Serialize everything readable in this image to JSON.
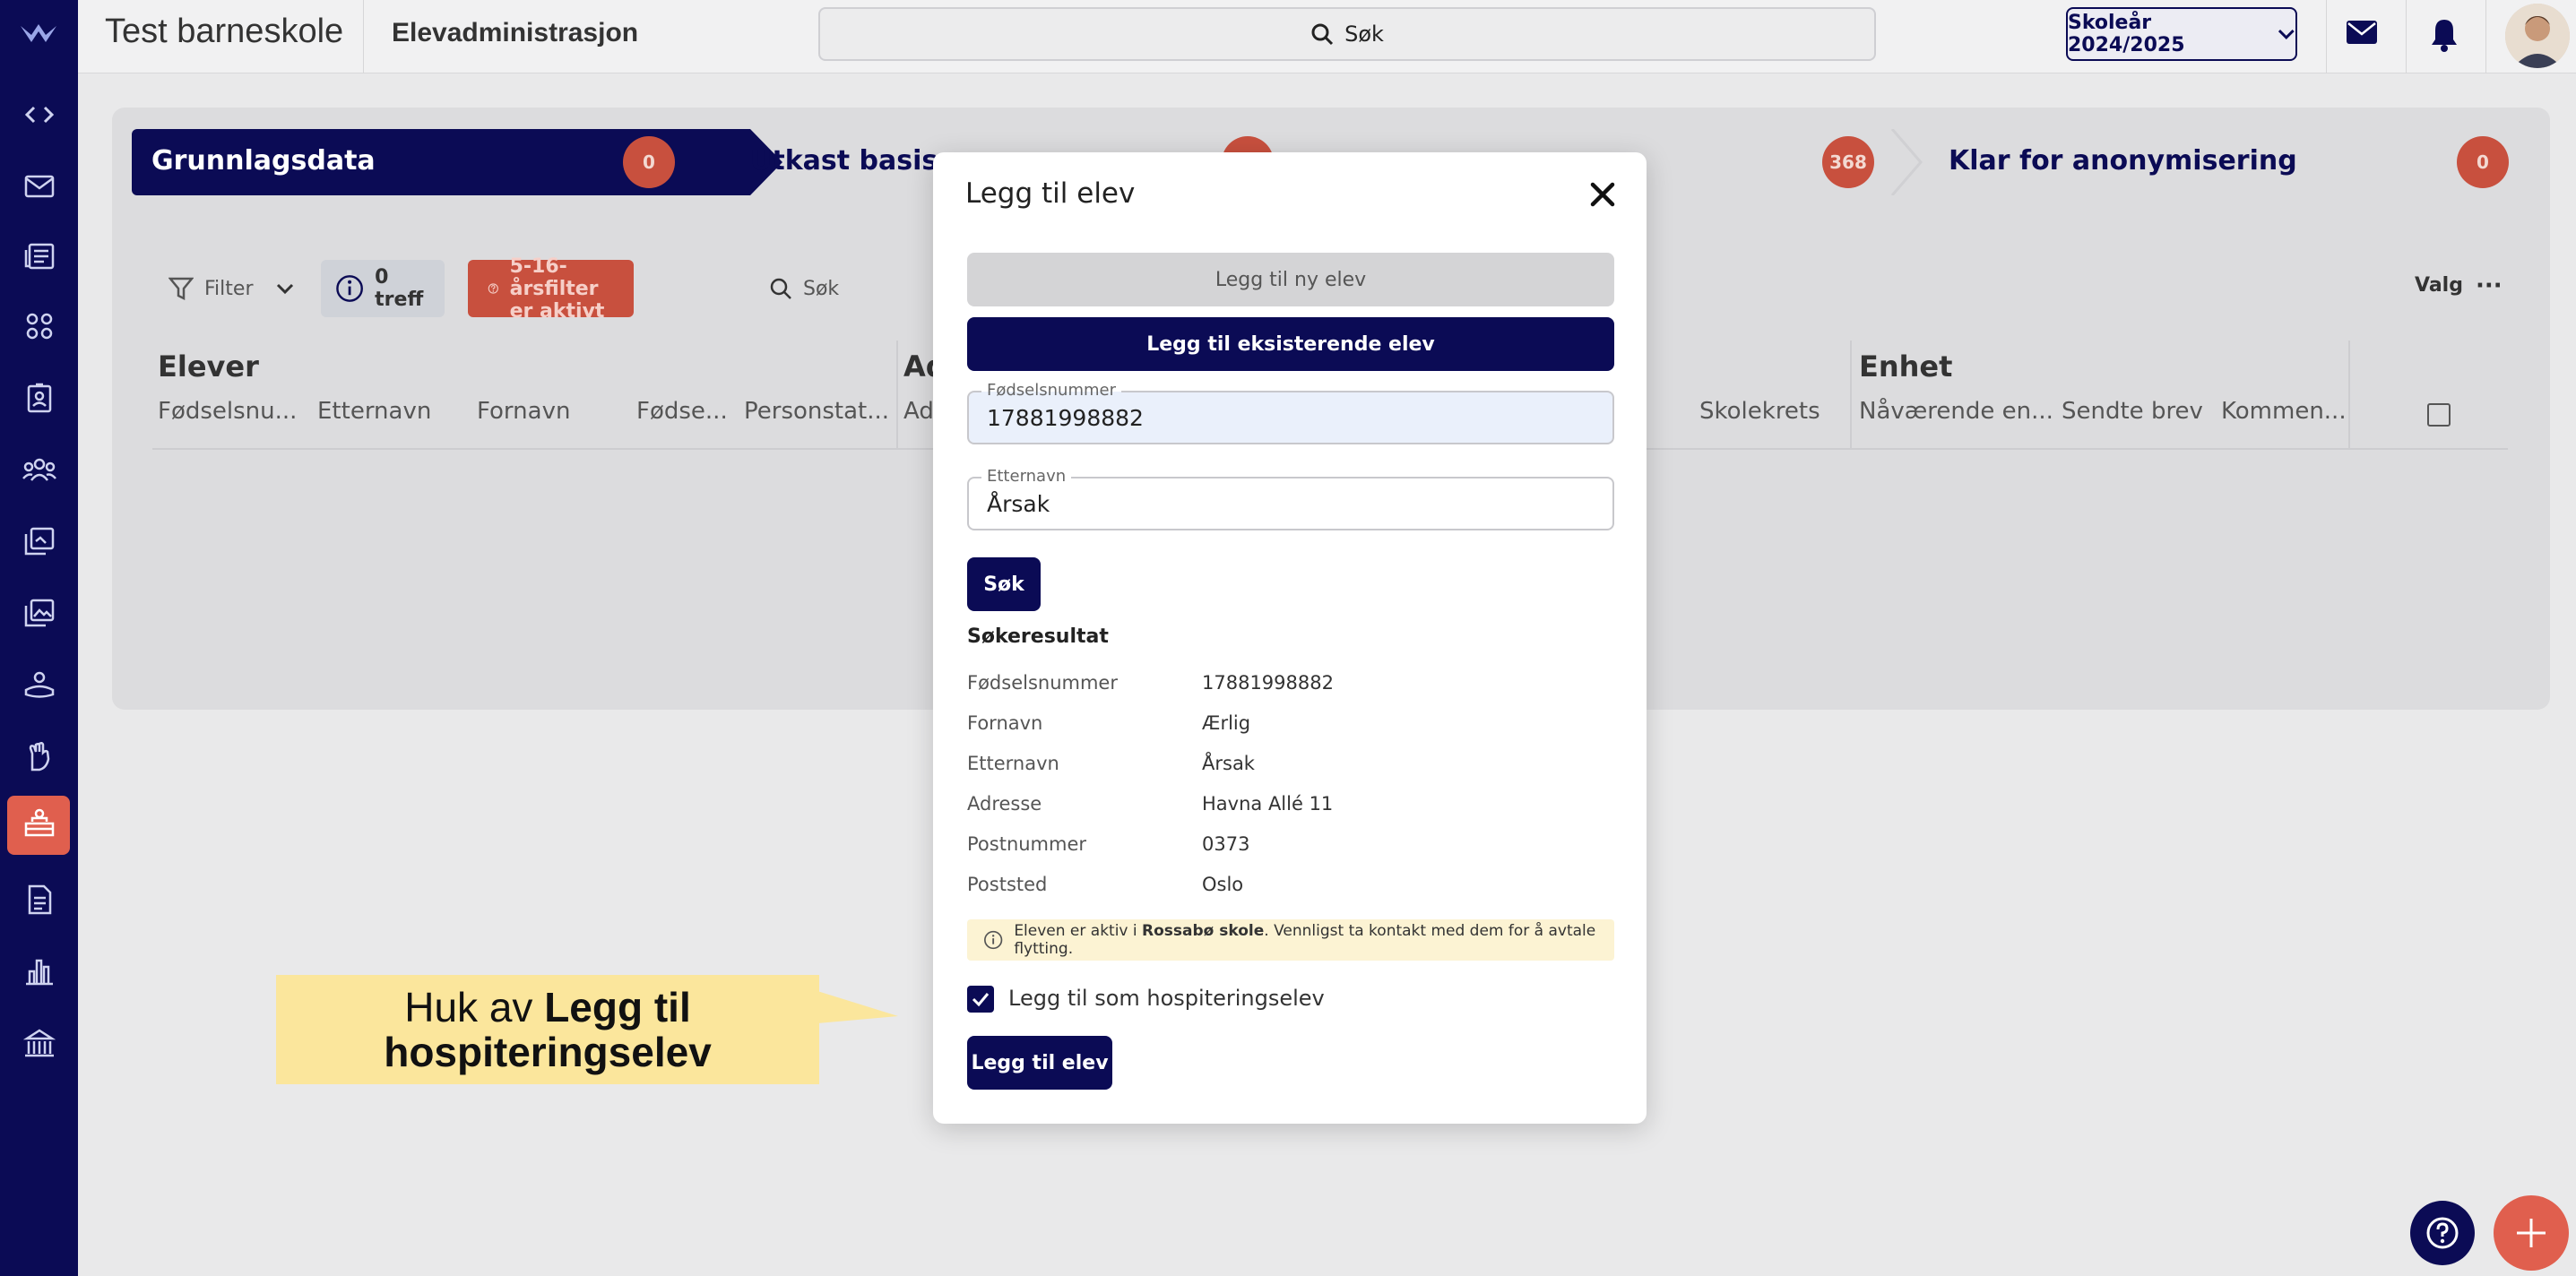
{
  "header": {
    "school_name": "Test barneskole",
    "module_title": "Elevadministrasjon",
    "search_label": "Søk",
    "school_year": "Skoleår 2024/2025"
  },
  "steps": [
    {
      "label": "Grunnlagsdata",
      "count": "0"
    },
    {
      "label": "Utkast basisgr",
      "count": ""
    },
    {
      "label": "",
      "count": "368"
    },
    {
      "label": "Klar for anonymisering",
      "count": "0"
    }
  ],
  "toolbar": {
    "filter_label": "Filter",
    "hits_label": "0 treff",
    "age_filter_label": "5-16-årsfilter er aktivt",
    "search_label": "Søk",
    "options_label": "Valg"
  },
  "table": {
    "groups": [
      "Elever",
      "Ad",
      "Enhet"
    ],
    "columns": [
      "Fødselsnu...",
      "Etternavn",
      "Fornavn",
      "Fødse...",
      "Personstat...",
      "Ad",
      "Skolekrets",
      "Nåværende en...",
      "Sendte brev",
      "Kommen..."
    ]
  },
  "modal": {
    "title": "Legg til elev",
    "new_student_button": "Legg til ny elev",
    "existing_student_button": "Legg til eksisterende elev",
    "ssn_label": "Fødselsnummer",
    "ssn_value": "17881998882",
    "lastname_label": "Etternavn",
    "lastname_value": "Årsak",
    "search_button": "Søk",
    "results_title": "Søkeresultat",
    "results": [
      {
        "key": "Fødselsnummer",
        "value": "17881998882"
      },
      {
        "key": "Fornavn",
        "value": "Ærlig"
      },
      {
        "key": "Etternavn",
        "value": "Årsak"
      },
      {
        "key": "Adresse",
        "value": "Havna Allé 11"
      },
      {
        "key": "Postnummer",
        "value": "0373"
      },
      {
        "key": "Poststed",
        "value": "Oslo"
      }
    ],
    "info_prefix": "Eleven er aktiv i ",
    "info_school": "Rossabø skole",
    "info_suffix": ". Vennligst ta kontakt med dem for å avtale flytting.",
    "checkbox_label": "Legg til som hospiteringselev",
    "checkbox_checked": true,
    "submit_button": "Legg til elev"
  },
  "callout": {
    "prefix": "Huk av ",
    "bold_line1": "Legg til",
    "bold_line2": "hospiteringselev"
  },
  "colors": {
    "navy": "#0b0b55",
    "accent_red": "#e05f4e",
    "badge_red": "#c8503e",
    "callout_yellow": "#fbe69c"
  }
}
